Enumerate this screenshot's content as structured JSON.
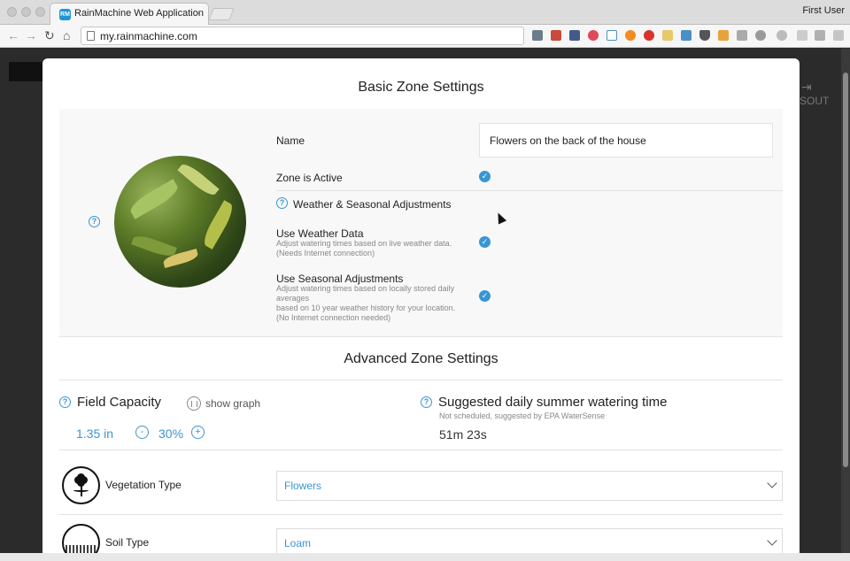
{
  "browser": {
    "tab_title": "RainMachine Web Application",
    "tab_favicon_text": "RM",
    "tab_close": "×",
    "profile": "First User",
    "url": "my.rainmachine.com",
    "back_glyph": "←",
    "forward_glyph": "→",
    "reload_glyph": "↻",
    "home_glyph": "⌂"
  },
  "background_page": {
    "logout_label": "SOUT",
    "logout_glyph": "⇥"
  },
  "modal": {
    "basic_title": "Basic Zone Settings",
    "name_label": "Name",
    "name_value": "Flowers on the back of the house",
    "zone_active_label": "Zone is Active",
    "weather_section_label": "Weather & Seasonal Adjustments",
    "use_weather_label": "Use Weather Data",
    "use_weather_desc1": "Adjust watering times based on live weather data.",
    "use_weather_desc2": "(Needs Internet connection)",
    "use_seasonal_label": "Use Seasonal Adjustments",
    "use_seasonal_desc1": "Adjust watering times based on locally stored daily",
    "use_seasonal_desc2": "averages",
    "use_seasonal_desc3": "based on 10 year weather history for your location.",
    "use_seasonal_desc4": "(No Internet connection needed)",
    "check_glyph": "✓",
    "help_glyph": "?",
    "advanced_title": "Advanced Zone Settings",
    "field_capacity_label": "Field Capacity",
    "show_graph_label": "show graph",
    "field_capacity_value": "1.35 in",
    "minus_glyph": "-",
    "plus_glyph": "+",
    "percent_value": "30%",
    "suggested_label": "Suggested daily summer watering time",
    "suggested_note": "Not scheduled, suggested by EPA WaterSense",
    "suggested_time": "51m 23s",
    "vegetation_label": "Vegetation Type",
    "vegetation_value": "Flowers",
    "soil_label": "Soil Type",
    "soil_value": "Loam"
  },
  "colors": {
    "accent": "#3a95d2",
    "modal_bg": "#ffffff",
    "page_bg": "#2b2b2b"
  }
}
